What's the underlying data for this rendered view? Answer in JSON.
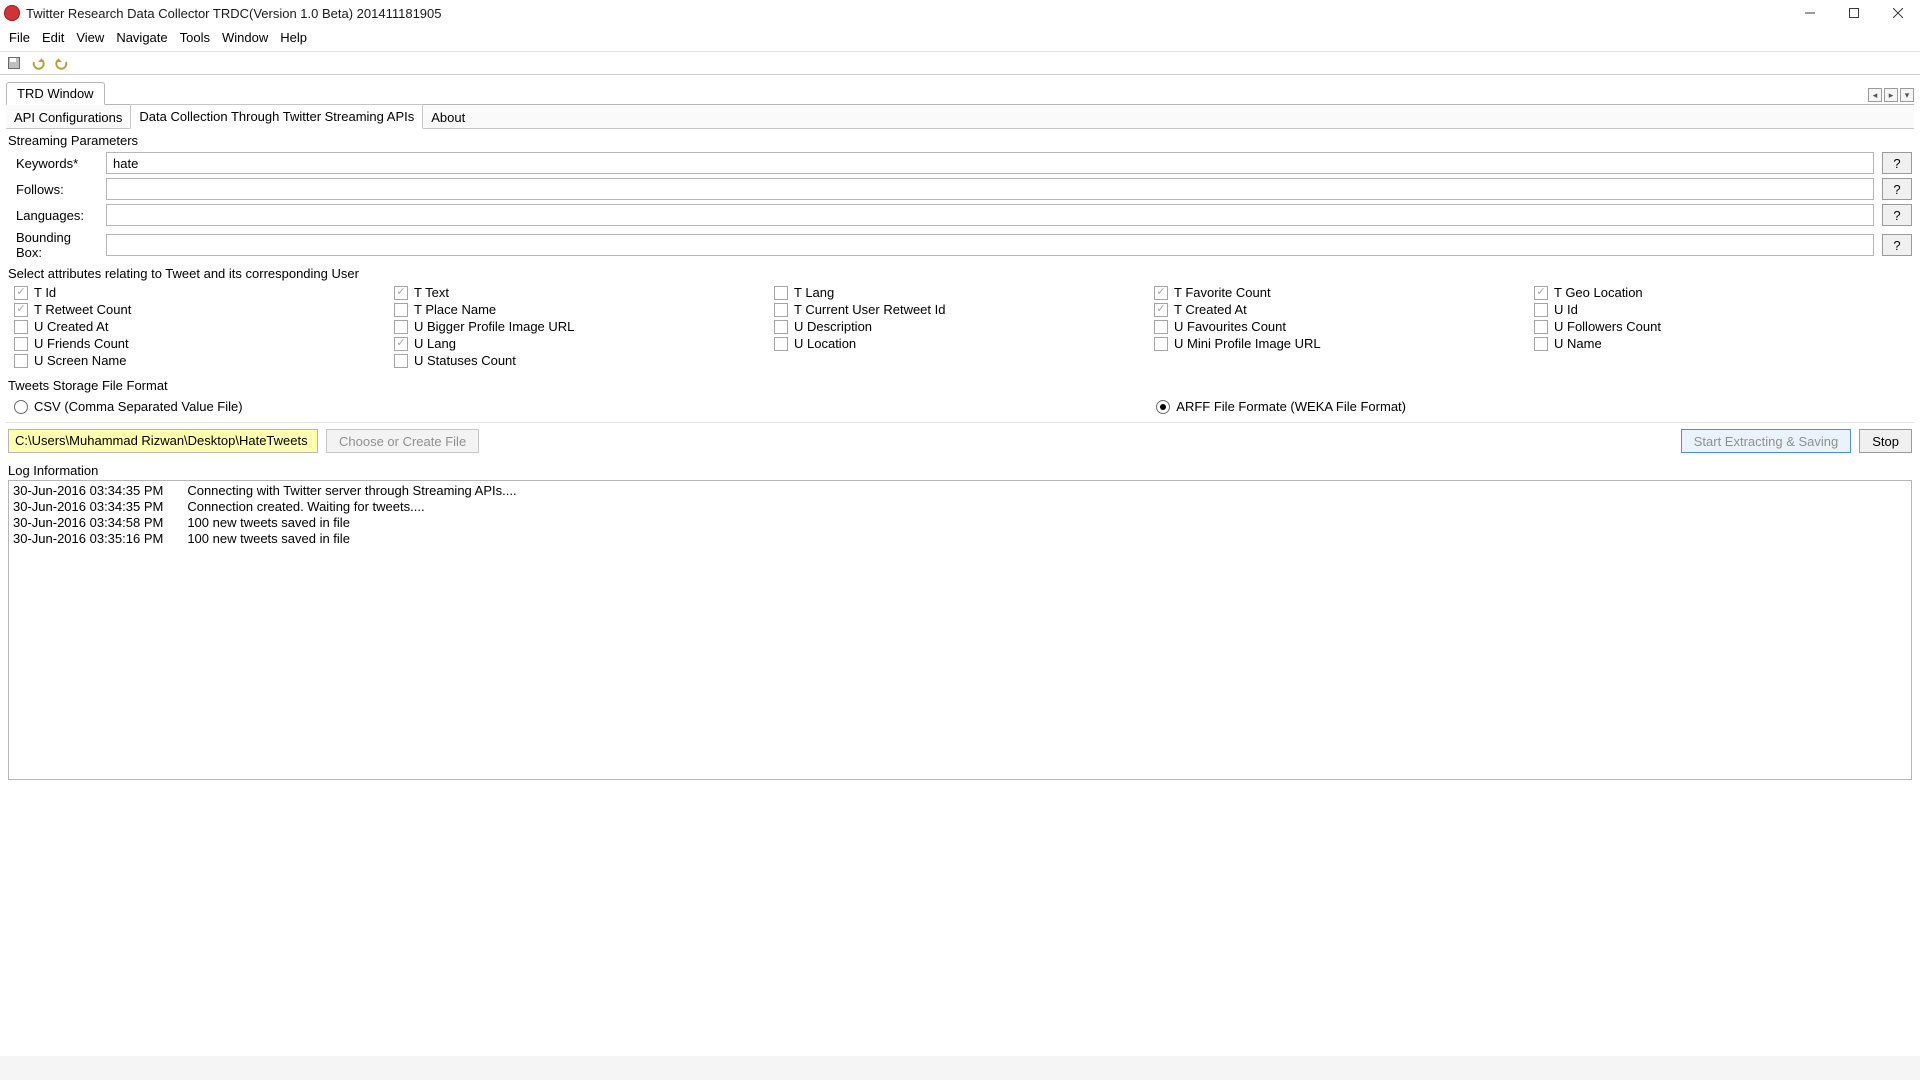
{
  "window": {
    "title": "Twitter Research Data Collector TRDC(Version 1.0 Beta) 201411181905"
  },
  "menu": [
    "File",
    "Edit",
    "View",
    "Navigate",
    "Tools",
    "Window",
    "Help"
  ],
  "outer_tab": "TRD Window",
  "tab_ctrls": {
    "left": "◂",
    "right": "▸",
    "min": "▾"
  },
  "inner_tabs": {
    "api": "API Configurations",
    "data": "Data Collection Through Twitter Streaming APIs",
    "about": "About"
  },
  "streaming": {
    "section": "Streaming Parameters",
    "keywords_label": "Keywords*",
    "keywords_value": "hate",
    "follows_label": "Follows:",
    "follows_value": "",
    "languages_label": "Languages:",
    "languages_value": "",
    "bbox_label": "Bounding Box:",
    "bbox_value": "",
    "help": "?"
  },
  "attr": {
    "section": "Select attributes relating to Tweet and its corresponding User",
    "t_id": "T Id",
    "t_text": "T Text",
    "t_lang": "T Lang",
    "t_fav": "T Favorite Count",
    "t_geo": "T Geo Location",
    "t_rt": "T Retweet Count",
    "t_place": "T Place Name",
    "t_cur_urt": "T Current User Retweet Id",
    "t_created": "T Created At",
    "u_id": "U Id",
    "u_created": "U Created At",
    "u_bigimg": "U Bigger Profile Image URL",
    "u_desc": "U Description",
    "u_favcnt": "U Favourites Count",
    "u_foll": "U Followers Count",
    "u_friends": "U Friends Count",
    "u_lang": "U Lang",
    "u_loc": "U Location",
    "u_miniimg": "U Mini Profile Image URL",
    "u_name": "U Name",
    "u_screen": "U Screen Name",
    "u_status": "U Statuses Count"
  },
  "storage": {
    "section": "Tweets Storage File Format",
    "csv": "CSV (Comma Separated Value File)",
    "arff": "ARFF File Formate (WEKA File Format)"
  },
  "file": {
    "path": "C:\\Users\\Muhammad Rizwan\\Desktop\\HateTweets",
    "choose": "Choose or Create File",
    "start": "Start Extracting & Saving",
    "stop": "Stop"
  },
  "log": {
    "section": "Log Information",
    "rows": [
      {
        "ts": "30-Jun-2016 03:34:35 PM",
        "msg": "Connecting with Twitter server through Streaming APIs...."
      },
      {
        "ts": "30-Jun-2016 03:34:35 PM",
        "msg": "Connection created. Waiting for tweets...."
      },
      {
        "ts": "30-Jun-2016 03:34:58 PM",
        "msg": "100 new tweets saved in file"
      },
      {
        "ts": "30-Jun-2016 03:35:16 PM",
        "msg": "100 new tweets saved in file"
      }
    ]
  }
}
